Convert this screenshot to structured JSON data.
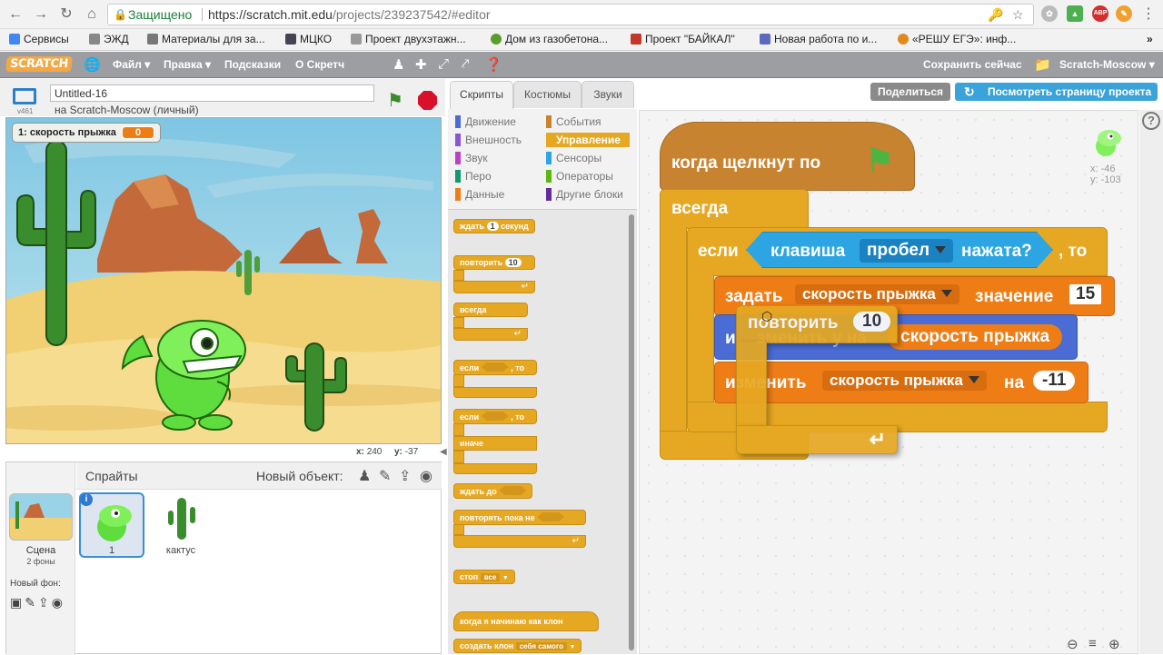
{
  "browser": {
    "secure_label": "Защищено",
    "url_host": "https://scratch.mit.edu",
    "url_path": "/projects/239237542/#editor",
    "ext_badge": "АВР"
  },
  "bookmarks": [
    {
      "label": "Сервисы",
      "color": "#4285f4"
    },
    {
      "label": "ЭЖД",
      "color": "#888"
    },
    {
      "label": "Материалы для за...",
      "color": "#777"
    },
    {
      "label": "МЦКО",
      "color": "#445"
    },
    {
      "label": "Проект двухэтажн...",
      "color": "#999"
    },
    {
      "label": "Дом из газобетона...",
      "color": "#5a9e2d"
    },
    {
      "label": "Проект \"БАЙКАЛ\"",
      "color": "#c0392b"
    },
    {
      "label": "Новая работа по и...",
      "color": "#5b6abf"
    },
    {
      "label": "«РЕШУ ЕГЭ»: инф...",
      "color": "#e08a1e"
    }
  ],
  "menu": {
    "logo": "SCRATCH",
    "file": "Файл ▾",
    "edit": "Правка ▾",
    "tips": "Подсказки",
    "about": "О Скретч",
    "save_now": "Сохранить сейчас",
    "user": "Scratch-Moscow ▾"
  },
  "project": {
    "title": "Untitled-16",
    "owner": "на Scratch-Moscow (личный)",
    "version": "v461"
  },
  "monitor": {
    "label": "1: скорость прыжка",
    "value": "0"
  },
  "stage_coords": {
    "x_label": "x:",
    "x": "240",
    "y_label": "y:",
    "y": "-37"
  },
  "sprites": {
    "title": "Спрайты",
    "new_object": "Новый объект:",
    "stage_label": "Сцена",
    "stage_sub": "2 фоны",
    "new_backdrop": "Новый фон:",
    "items": [
      {
        "name": "1"
      },
      {
        "name": "кактус"
      }
    ],
    "info_badge": "i"
  },
  "tabs": [
    "Скрипты",
    "Костюмы",
    "Звуки"
  ],
  "categories": [
    {
      "label": "Движение",
      "color": "#4a6cd4"
    },
    {
      "label": "События",
      "color": "#c88330"
    },
    {
      "label": "Внешность",
      "color": "#8a55d7"
    },
    {
      "label": "Управление",
      "color": "#e6a822"
    },
    {
      "label": "Звук",
      "color": "#bb42c3"
    },
    {
      "label": "Сенсоры",
      "color": "#2ca5e2"
    },
    {
      "label": "Перо",
      "color": "#0e9a6c"
    },
    {
      "label": "Операторы",
      "color": "#5cb712"
    },
    {
      "label": "Данные",
      "color": "#ee7d16"
    },
    {
      "label": "Другие блоки",
      "color": "#632d99"
    }
  ],
  "palette": {
    "wait_pre": "ждать",
    "wait_num": "1",
    "wait_post": "секунд",
    "repeat": "повторить",
    "repeat_num": "10",
    "forever": "всегда",
    "if": "если",
    "then": ", то",
    "else": "иначе",
    "wait_until": "ждать до",
    "repeat_until": "повторять пока не",
    "stop": "стоп",
    "stop_opt": "все",
    "clone_start": "когда я начинаю как клон",
    "create_clone": "создать клон",
    "create_clone_opt": "себя самого"
  },
  "top_buttons": {
    "share": "Поделиться",
    "see_page": "Посмотреть страницу проекта"
  },
  "sprite_xy": {
    "x": "x: -46",
    "y": "y: -103"
  },
  "script": {
    "hat": "когда щелкнут по",
    "forever": "всегда",
    "if": "если",
    "key_pre": "клавиша",
    "key": "пробел",
    "key_post": "нажата?",
    "then": ", то",
    "set": "задать",
    "var": "скорость прыжка",
    "to": "значение",
    "set_val": "15",
    "change_a": "и",
    "change_a_hidden": "зменить у на",
    "change_a_var": "скорость прыжка",
    "change": "изменить",
    "by": "на",
    "change_val": "-11",
    "drag_repeat": "повторить",
    "drag_num": "10"
  },
  "colors": {
    "control": "#e6a822",
    "data": "#ee7d16",
    "sensing": "#2ca5e2",
    "motion": "#4a6cd4",
    "share": "#8a8a8a",
    "see_page": "#3aa3d9"
  }
}
